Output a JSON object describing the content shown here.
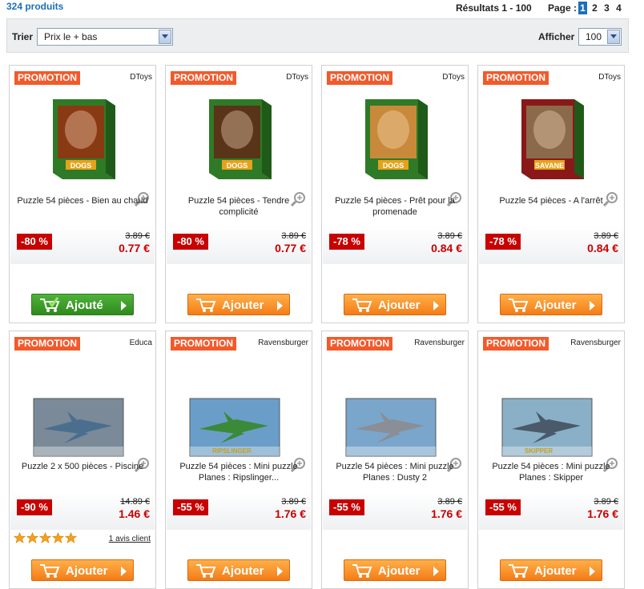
{
  "header": {
    "count": "324 produits",
    "results": "Résultats 1 - 100",
    "page_label": "Page :",
    "pages": [
      "1",
      "2",
      "3",
      "4"
    ]
  },
  "toolbar": {
    "sort_label": "Trier",
    "sort_value": "Prix le + bas",
    "show_label": "Afficher",
    "show_value": "100"
  },
  "colors": {
    "promo": "#f25a2b",
    "discount": "#c80000",
    "orange_button": "#f47c16",
    "green_button": "#2f8a1e",
    "link": "#1d6fb8"
  },
  "products": [
    {
      "promo": "PROMOTION",
      "brand": "DToys",
      "title": "Puzzle 54 pièces - Bien au chaud",
      "discount": "-80 %",
      "old_price": "3.89 €",
      "new_price": "0.77 €",
      "button": "Ajouté",
      "button_state": "added"
    },
    {
      "promo": "PROMOTION",
      "brand": "DToys",
      "title": "Puzzle 54 pièces - Tendre complicité",
      "discount": "-80 %",
      "old_price": "3.89 €",
      "new_price": "0.77 €",
      "button": "Ajouter",
      "button_state": "default"
    },
    {
      "promo": "PROMOTION",
      "brand": "DToys",
      "title": "Puzzle 54 pièces - Prêt pour la promenade",
      "discount": "-78 %",
      "old_price": "3.89 €",
      "new_price": "0.84 €",
      "button": "Ajouter",
      "button_state": "default"
    },
    {
      "promo": "PROMOTION",
      "brand": "DToys",
      "title": "Puzzle 54 pièces - A l'arrêt",
      "discount": "-78 %",
      "old_price": "3.89 €",
      "new_price": "0.84 €",
      "button": "Ajouter",
      "button_state": "default"
    },
    {
      "promo": "PROMOTION",
      "brand": "Educa",
      "title": "Puzzle 2 x 500 pièces - Piscine",
      "discount": "-90 %",
      "old_price": "14.89 €",
      "new_price": "1.46 €",
      "button": "Ajouter",
      "button_state": "default",
      "rating": 5,
      "reviews": "1 avis client"
    },
    {
      "promo": "PROMOTION",
      "brand": "Ravensburger",
      "title": "Puzzle 54 pièces : Mini puzzle Planes : Ripslinger...",
      "discount": "-55 %",
      "old_price": "3.89 €",
      "new_price": "1.76 €",
      "button": "Ajouter",
      "button_state": "default"
    },
    {
      "promo": "PROMOTION",
      "brand": "Ravensburger",
      "title": "Puzzle 54 pièces : Mini puzzle Planes : Dusty 2",
      "discount": "-55 %",
      "old_price": "3.89 €",
      "new_price": "1.76 €",
      "button": "Ajouter",
      "button_state": "default"
    },
    {
      "promo": "PROMOTION",
      "brand": "Ravensburger",
      "title": "Puzzle 54 pièces : Mini puzzle Planes : Skipper",
      "discount": "-55 %",
      "old_price": "3.89 €",
      "new_price": "1.76 €",
      "button": "Ajouter",
      "button_state": "default"
    }
  ]
}
